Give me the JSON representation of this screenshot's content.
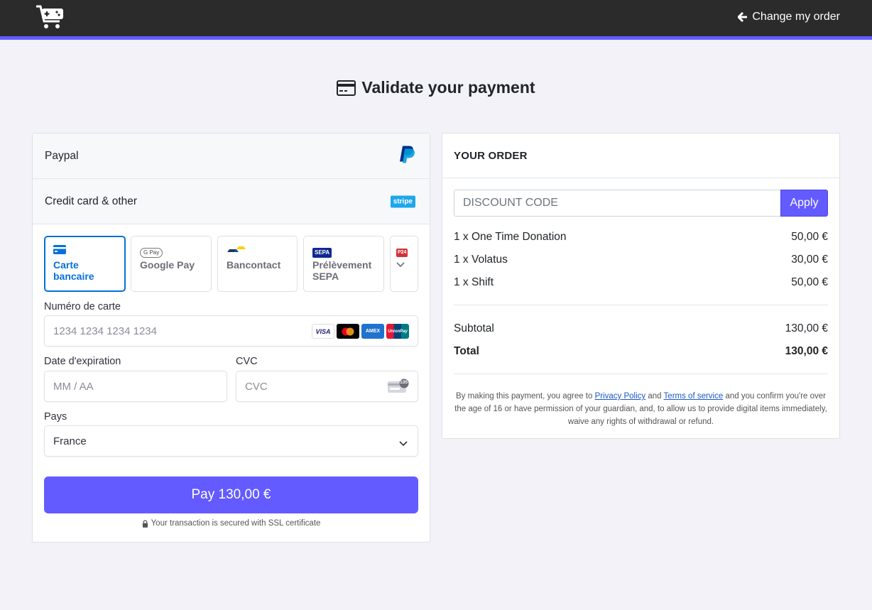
{
  "header": {
    "logo_icon": "cart-gamepad-icon",
    "change_order_label": "Change my order"
  },
  "page": {
    "title": "Validate your payment",
    "title_icon": "credit-card-icon"
  },
  "payment": {
    "methods": [
      {
        "label": "Paypal",
        "logo": "paypal-logo"
      },
      {
        "label": "Credit card & other",
        "logo": "stripe-logo",
        "logo_text": "stripe"
      }
    ],
    "tabs": [
      {
        "label_line1": "Carte",
        "label_line2": "bancaire",
        "icon": "card-icon",
        "active": true
      },
      {
        "label_line1": "Google Pay",
        "label_line2": "",
        "icon": "google-pay-icon",
        "icon_text": "G Pay"
      },
      {
        "label_line1": "Bancontact",
        "label_line2": "",
        "icon": "bancontact-icon"
      },
      {
        "label_line1": "Prélèvement",
        "label_line2": "SEPA",
        "icon": "sepa-icon",
        "icon_text": "SEPA"
      },
      {
        "label_line1": "",
        "label_line2": "",
        "icon": "p24-icon",
        "icon_text": "P24"
      }
    ],
    "card_number": {
      "label": "Numéro de carte",
      "placeholder": "1234 1234 1234 1234",
      "brands": [
        {
          "name": "visa",
          "text": "VISA",
          "color": "#1a1f71"
        },
        {
          "name": "mastercard",
          "text": "",
          "color": "#000000"
        },
        {
          "name": "amex",
          "text": "AMEX",
          "color": "#1f72cd"
        },
        {
          "name": "unionpay",
          "text": "UnionPay",
          "color": "#e21836"
        }
      ]
    },
    "expiry": {
      "label": "Date d'expiration",
      "placeholder": "MM / AA"
    },
    "cvc": {
      "label": "CVC",
      "placeholder": "CVC",
      "badge": "135"
    },
    "country": {
      "label": "Pays",
      "value": "France"
    },
    "pay_button": "Pay 130,00 €",
    "secure_note": "Your transaction is secured with SSL certificate"
  },
  "order": {
    "title": "YOUR ORDER",
    "discount_placeholder": "DISCOUNT CODE",
    "apply_label": "Apply",
    "items": [
      {
        "name": "1 x One Time Donation",
        "price": "50,00 €"
      },
      {
        "name": "1 x Volatus",
        "price": "30,00 €"
      },
      {
        "name": "1 x Shift",
        "price": "50,00 €"
      }
    ],
    "subtotal_label": "Subtotal",
    "subtotal_value": "130,00 €",
    "total_label": "Total",
    "total_value": "130,00 €",
    "terms": {
      "part1": "By making this payment, you agree to ",
      "privacy": "Privacy Policy",
      "part2": " and ",
      "tos": "Terms of service",
      "part3": " and you confirm you're over the age of 16 or have permission of your guardian, and, to allow us to provide digital items immediately, waive any rights of withdrawal or refund."
    }
  },
  "colors": {
    "accent": "#635bff",
    "active_tab": "#0570de",
    "header_bg": "#2b2b2b"
  }
}
